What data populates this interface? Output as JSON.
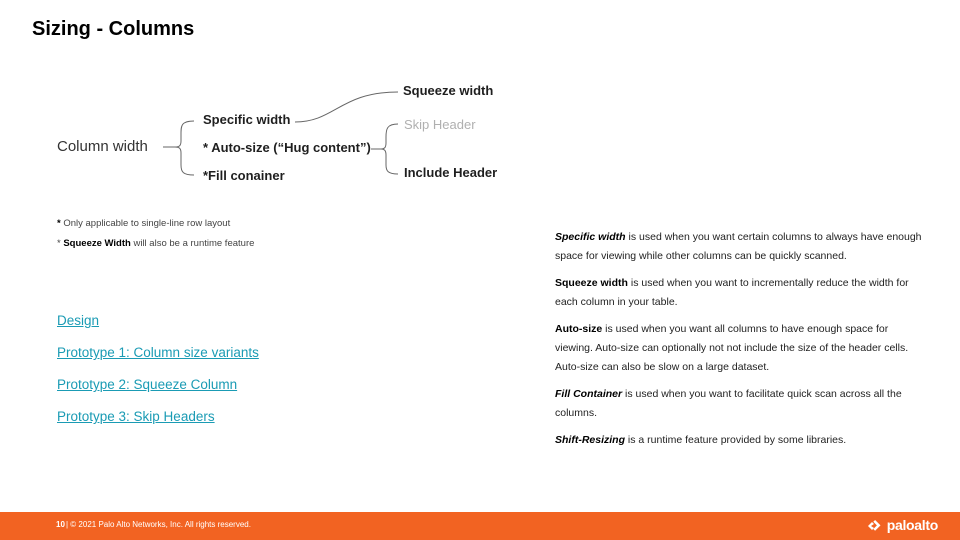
{
  "title": "Sizing - Columns",
  "diagram": {
    "root": "Column width",
    "level1": [
      "Specific width",
      "* Auto-size (“Hug content”)",
      "*Fill conainer"
    ],
    "level2_top": "Squeeze width",
    "level2_mid": "Skip Header",
    "level2_bottom": "Include Header"
  },
  "notes": {
    "note1_mark": "*",
    "note1_text": " Only  applicable to single-line row layout",
    "note2_mark": "* ",
    "note2_bold": "Squeeze Width",
    "note2_text": " will also be  a runtime feature"
  },
  "links": [
    "Design",
    "Prototype 1: Column size variants",
    "Prototype 2: Squeeze Column",
    "Prototype 3: Skip Headers"
  ],
  "descriptions": [
    {
      "term": "Specific width",
      "text": " is used when you want certain columns to always have enough space for viewing while other columns can be quickly scanned."
    },
    {
      "term": "Squeeze width",
      "text": " is used when you want to incrementally reduce the width for each column in your table."
    },
    {
      "term": "Auto-size",
      "text": " is used when you want all columns to have enough space for viewing. Auto-size can optionally not not include the size of the header cells. Auto-size can also be slow on a large dataset."
    },
    {
      "term": "Fill Container",
      "text": " is used when you want to facilitate quick scan across all the columns."
    },
    {
      "term": "Shift-Resizing",
      "text": " is a runtime feature provided by some libraries."
    }
  ],
  "footer": {
    "page": "10",
    "copyright": " |  © 2021 Palo Alto Networks, Inc. All rights reserved.",
    "logo": "paloalto",
    "logo_mark_icon": "paloalto-chevrons-icon",
    "color": "#f26322"
  },
  "colors": {
    "link": "#1a9bb4",
    "muted": "#b0b0b0"
  }
}
